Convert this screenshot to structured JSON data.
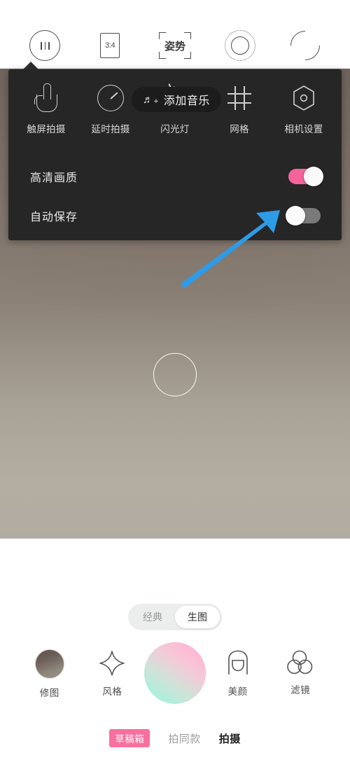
{
  "topbar": {
    "items": [
      {
        "name": "settings-sliders",
        "icon": "sliders-circle-icon",
        "label": ""
      },
      {
        "name": "aspect-ratio",
        "icon": "ratio-icon",
        "label": "3:4"
      },
      {
        "name": "pose-guide",
        "icon": "pose-frame-icon",
        "label": "姿势"
      },
      {
        "name": "beauty-dot-ring",
        "icon": "dot-ring-icon",
        "label": ""
      },
      {
        "name": "flip-camera",
        "icon": "camera-flip-icon",
        "label": ""
      }
    ]
  },
  "settings_panel": {
    "quick_items": [
      {
        "label": "触屏拍摄",
        "icon": "hand-tap-icon"
      },
      {
        "label": "延时拍摄",
        "icon": "timer-icon"
      },
      {
        "label": "闪光灯",
        "icon": "flash-off-icon"
      },
      {
        "label": "网格",
        "icon": "grid-icon"
      },
      {
        "label": "相机设置",
        "icon": "camera-hex-icon"
      }
    ],
    "music_pill": {
      "label": "添加音乐",
      "icon": "music-note-plus-icon"
    },
    "toggles": [
      {
        "label": "高清画质",
        "state": "on",
        "color": "#F4649B"
      },
      {
        "label": "自动保存",
        "state": "off",
        "color": "#7A7A7A"
      }
    ]
  },
  "viewfinder": {
    "focus_ring": "focus-ring",
    "annotation_arrow": {
      "color": "#2E9BE8",
      "points_to": "自动保存"
    }
  },
  "lower": {
    "mode_segment": {
      "options": [
        "经典",
        "生图"
      ],
      "selected": "生图"
    },
    "actions": [
      {
        "label": "修图",
        "icon": "photo-thumbnail-icon"
      },
      {
        "label": "风格",
        "icon": "sparkle-diamond-icon"
      },
      {
        "label": "",
        "icon": "shutter-button-icon"
      },
      {
        "label": "美颜",
        "icon": "face-beauty-icon"
      },
      {
        "label": "滤镜",
        "icon": "filters-circles-icon"
      }
    ],
    "tabs": [
      {
        "label": "草稿箱",
        "style": "badge"
      },
      {
        "label": "拍同款",
        "style": "normal"
      },
      {
        "label": "拍摄",
        "style": "active"
      }
    ]
  }
}
